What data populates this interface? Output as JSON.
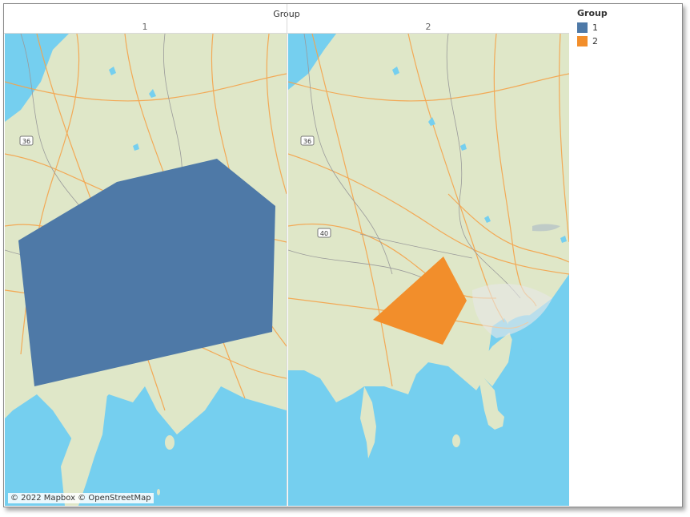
{
  "header": {
    "title": "Group"
  },
  "columns": [
    {
      "label": "1"
    },
    {
      "label": "2"
    }
  ],
  "legend": {
    "title": "Group",
    "items": [
      {
        "label": "1",
        "color": "#4e79a7"
      },
      {
        "label": "2",
        "color": "#f28e2b"
      }
    ]
  },
  "map": {
    "attribution": "© 2022 Mapbox © OpenStreetMap",
    "road_labels": [
      "36",
      "36",
      "40"
    ],
    "colors": {
      "land": "#dfe7c8",
      "water": "#75cfef",
      "roads": "#f5a34a",
      "borders": "#9a9a9a"
    }
  }
}
